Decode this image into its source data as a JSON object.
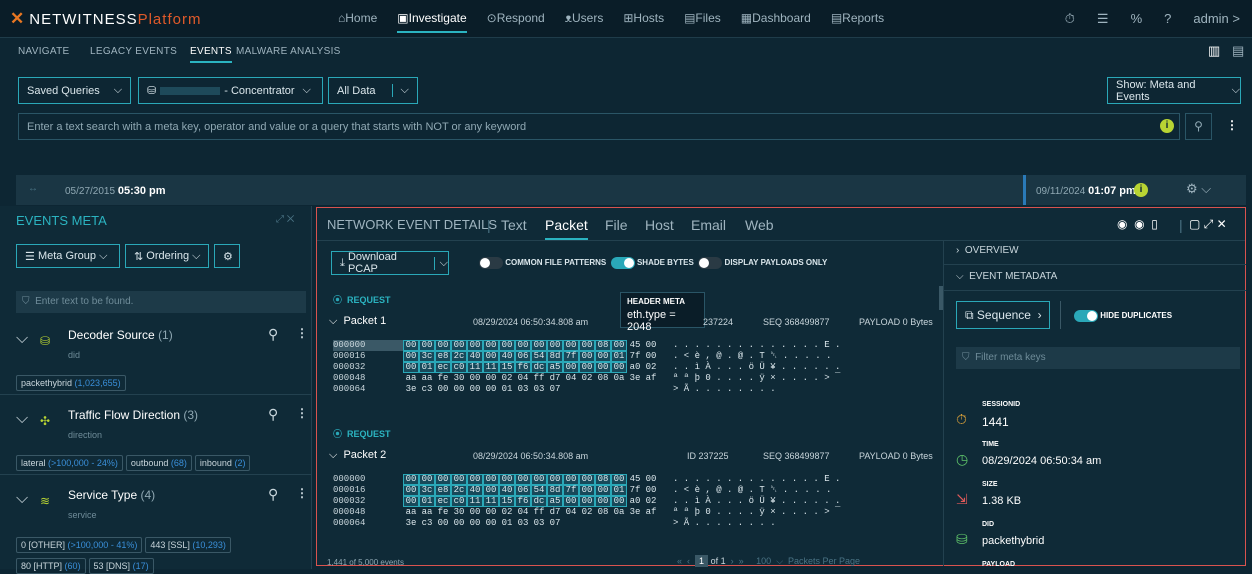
{
  "top": {
    "logo_nw": "NETWITNESS",
    "logo_pf": "Platform",
    "nav": [
      "⌂Home",
      "▣Investigate",
      "⊙Respond",
      "ᴥUsers",
      "⊞Hosts",
      "▤Files",
      "▦Dashboard",
      "▤Reports"
    ],
    "admin": "admin >"
  },
  "subnav": [
    "NAVIGATE",
    "LEGACY EVENTS",
    "EVENTS",
    "MALWARE ANALYSIS"
  ],
  "query": {
    "saved": "Saved Queries",
    "concentrator": "- Concentrator",
    "alldata": "All Data",
    "show": "Show: Meta and Events",
    "placeholder": "Enter a text search with a meta key, operator and value or a query that starts with NOT or any keyword"
  },
  "timeline": {
    "start_date": "05/27/2015",
    "start_time": "05:30 pm",
    "end_date": "09/11/2024",
    "end_time": "01:07 pm"
  },
  "left": {
    "title": "EVENTS META",
    "metagroup": "Meta Group",
    "ordering": "Ordering",
    "filter_ph": "Enter text to be found.",
    "items": [
      {
        "name": "Decoder Source",
        "count": "(1)",
        "key": "did",
        "values": [
          {
            "v": "packethybrid",
            "c": "(1,023,655)"
          }
        ]
      },
      {
        "name": "Traffic Flow Direction",
        "count": "(3)",
        "key": "direction",
        "values": [
          {
            "v": "lateral",
            "c": "(>100,000 - 24%)"
          },
          {
            "v": "outbound",
            "c": "(68)"
          },
          {
            "v": "inbound",
            "c": "(2)"
          }
        ]
      },
      {
        "name": "Service Type",
        "count": "(4)",
        "key": "service",
        "values": [
          {
            "v": "0 [OTHER]",
            "c": "(>100,000 - 41%)"
          },
          {
            "v": "443 [SSL]",
            "c": "(10,293)"
          },
          {
            "v": "80 [HTTP]",
            "c": "(60)"
          },
          {
            "v": "53 [DNS]",
            "c": "(17)"
          }
        ]
      }
    ]
  },
  "main": {
    "title": "NETWORK EVENT DETAILS",
    "tabs": [
      "Text",
      "Packet",
      "File",
      "Host",
      "Email",
      "Web"
    ],
    "download": "Download PCAP",
    "t1": "COMMON FILE PATTERNS",
    "t2": "SHADE BYTES",
    "t3": "DISPLAY PAYLOADS ONLY",
    "tooltip_title": "HEADER META",
    "tooltip_val": "eth.type = 2048",
    "packets": [
      {
        "req": "REQUEST",
        "name": "Packet 1",
        "ts": "08/29/2024 06:50:34.808 am",
        "id": "237224",
        "seq": "SEQ 368499877",
        "payload": "PAYLOAD 0 Bytes"
      },
      {
        "req": "REQUEST",
        "name": "Packet 2",
        "ts": "08/29/2024 06:50:34.808 am",
        "id": "ID 237225",
        "seq": "SEQ 368499877",
        "payload": "PAYLOAD 0 Bytes"
      }
    ],
    "hexrows": [
      {
        "off": "000000",
        "bytes": [
          "00",
          "00",
          "00",
          "00",
          "00",
          "00",
          "00",
          "00",
          "00",
          "00",
          "00",
          "00",
          "08",
          "00",
          "45",
          "00"
        ],
        "ascii": ". . . . . . . . . . . . . . E ."
      },
      {
        "off": "000016",
        "bytes": [
          "00",
          "3c",
          "e8",
          "2c",
          "40",
          "00",
          "40",
          "06",
          "54",
          "8d",
          "7f",
          "00",
          "00",
          "01",
          "7f",
          "00"
        ],
        "ascii": ". < è , @ . @ . T ␡ . . . . ."
      },
      {
        "off": "000032",
        "bytes": [
          "00",
          "01",
          "ec",
          "c0",
          "11",
          "11",
          "15",
          "f6",
          "dc",
          "a5",
          "00",
          "00",
          "00",
          "00",
          "a0",
          "02"
        ],
        "ascii": ". . ì À . . . ö Ü ¥ . . . . . ."
      },
      {
        "off": "000048",
        "bytes": [
          "aa",
          "aa",
          "fe",
          "30",
          "00",
          "00",
          "02",
          "04",
          "ff",
          "d7",
          "04",
          "02",
          "08",
          "0a",
          "3e",
          "af"
        ],
        "ascii": "ª ª þ 0 . . . . ÿ × . . . . > ¯"
      },
      {
        "off": "000064",
        "bytes": [
          "3e",
          "c3",
          "00",
          "00",
          "00",
          "00",
          "01",
          "03",
          "03",
          "07"
        ],
        "ascii": "> Ã . . . . . . . ."
      }
    ],
    "footer": {
      "events": "1,441 of 5,000 events",
      "page": "1",
      "of": "of 1",
      "per": "100",
      "ppp": "Packets Per Page"
    },
    "side": {
      "overview": "OVERVIEW",
      "eventmeta": "EVENT METADATA",
      "sequence": "Sequence",
      "hide": "HIDE DUPLICATES",
      "filter_ph": "Filter meta keys",
      "fields": [
        {
          "k": "SESSIONID",
          "v": "1441"
        },
        {
          "k": "TIME",
          "v": "08/29/2024 06:50:34 am"
        },
        {
          "k": "SIZE",
          "v": "1.38 KB"
        },
        {
          "k": "DID",
          "v": "packethybrid"
        },
        {
          "k": "PAYLOAD",
          "v": ""
        }
      ]
    }
  }
}
